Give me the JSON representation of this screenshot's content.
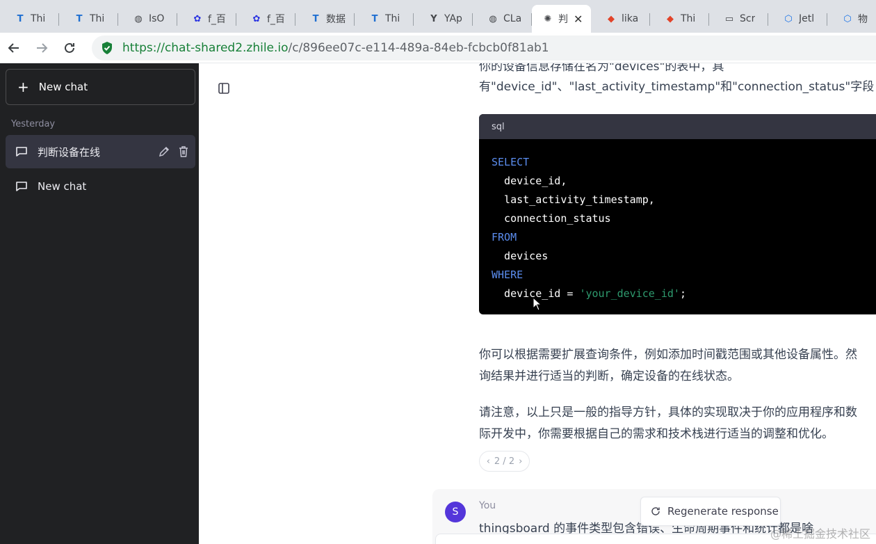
{
  "browser": {
    "tabs": [
      {
        "label": "Thi",
        "icon": "thingsboard-icon",
        "color": "#1f6fd1"
      },
      {
        "label": "Thi",
        "icon": "thingsboard-icon",
        "color": "#1f6fd1"
      },
      {
        "label": "IsO",
        "icon": "globe-icon",
        "color": "#45474b"
      },
      {
        "label": "f_百",
        "icon": "baidu-icon",
        "color": "#2932e1"
      },
      {
        "label": "f_百",
        "icon": "baidu-icon",
        "color": "#2932e1"
      },
      {
        "label": "数据",
        "icon": "thingsboard-icon",
        "color": "#1f6fd1"
      },
      {
        "label": "Thi",
        "icon": "thingsboard-icon",
        "color": "#1f6fd1"
      },
      {
        "label": "YAp",
        "icon": "yapi-icon",
        "color": "#45474b"
      },
      {
        "label": "CLa",
        "icon": "globe-icon",
        "color": "#45474b"
      },
      {
        "label": "判",
        "icon": "openai-icon",
        "color": "#45474b",
        "active": true
      },
      {
        "label": "lika",
        "icon": "gitlab-icon",
        "color": "#e24329"
      },
      {
        "label": "Thi",
        "icon": "gitlab-icon",
        "color": "#e24329"
      },
      {
        "label": "Scr",
        "icon": "monitor-icon",
        "color": "#45474b"
      },
      {
        "label": "Jetl",
        "icon": "cube-icon",
        "color": "#1a73e8"
      },
      {
        "label": "物",
        "icon": "cube-icon",
        "color": "#1a73e8"
      }
    ],
    "url": {
      "scheme": "https://",
      "host": "chat-shared2.zhile.io",
      "path": "/c/896ee07c-e114-489a-84eb-fcbcb0f81ab1"
    }
  },
  "sidebar": {
    "new_chat_label": "New chat",
    "section_label": "Yesterday",
    "conversations": [
      {
        "title": "判断设备在线",
        "active": true
      },
      {
        "title": "New chat",
        "active": false
      }
    ]
  },
  "main": {
    "intro_line1": "你的设备信息存储在名为\"devices\"的表中，具",
    "intro_line2": "有\"device_id\"、\"last_activity_timestamp\"和\"connection_status\"字段：",
    "code": {
      "language": "sql",
      "lines": [
        {
          "kw": "SELECT"
        },
        {
          "text": "  device_id,"
        },
        {
          "text": "  last_activity_timestamp,"
        },
        {
          "text": "  connection_status"
        },
        {
          "kw": "FROM"
        },
        {
          "text": "  devices"
        },
        {
          "kw": "WHERE"
        },
        {
          "text": "  device_id = ",
          "str": "'your_device_id'",
          "after": ";"
        }
      ]
    },
    "para2_line1": "你可以根据需要扩展查询条件，例如添加时间戳范围或其他设备属性。然",
    "para2_line2": "询结果并进行适当的判断，确定设备的在线状态。",
    "para3_line1": "请注意，以上只是一般的指导方针，具体的实现取决于你的应用程序和数",
    "para3_line2": "际开发中，你需要根据自己的需求和技术栈进行适当的调整和优化。",
    "pager": "2 / 2",
    "user_avatar": "S",
    "user_label": "You",
    "user_message": "thingsboard 的事件类型包含错误、生命周期事件和统计都是啥",
    "regenerate_label": "Regenerate response"
  },
  "watermark": "@稀土掘金技术社区"
}
